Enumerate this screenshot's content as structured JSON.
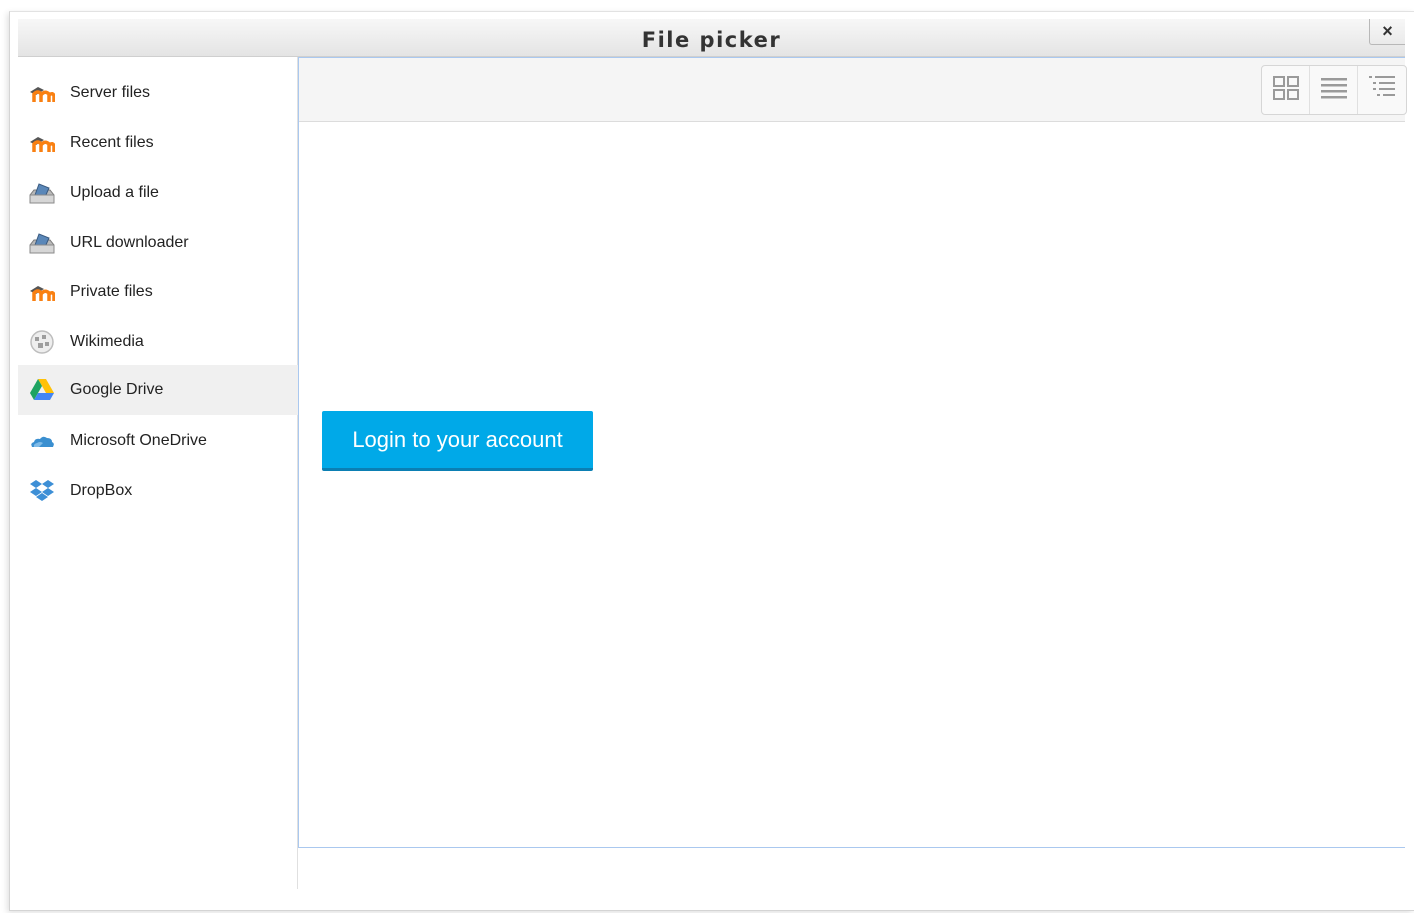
{
  "dialog": {
    "title": "File picker",
    "close_label": "×"
  },
  "sidebar": {
    "items": [
      {
        "label": "Server files",
        "icon": "moodle-icon"
      },
      {
        "label": "Recent files",
        "icon": "moodle-icon"
      },
      {
        "label": "Upload a file",
        "icon": "upload-icon"
      },
      {
        "label": "URL downloader",
        "icon": "upload-icon"
      },
      {
        "label": "Private files",
        "icon": "moodle-icon"
      },
      {
        "label": "Wikimedia",
        "icon": "wikimedia-globe-icon"
      },
      {
        "label": "Google Drive",
        "icon": "google-drive-icon",
        "selected": true
      },
      {
        "label": "Microsoft OneDrive",
        "icon": "onedrive-cloud-icon"
      },
      {
        "label": "DropBox",
        "icon": "dropbox-icon"
      }
    ]
  },
  "toolbar": {
    "views": [
      "icons-view",
      "list-view",
      "tree-view"
    ]
  },
  "main": {
    "login_label": "Login to your account"
  },
  "colors": {
    "accent": "#00a9e8",
    "panel_border": "#aac8ef",
    "selected_bg": "#f0f0f0"
  }
}
